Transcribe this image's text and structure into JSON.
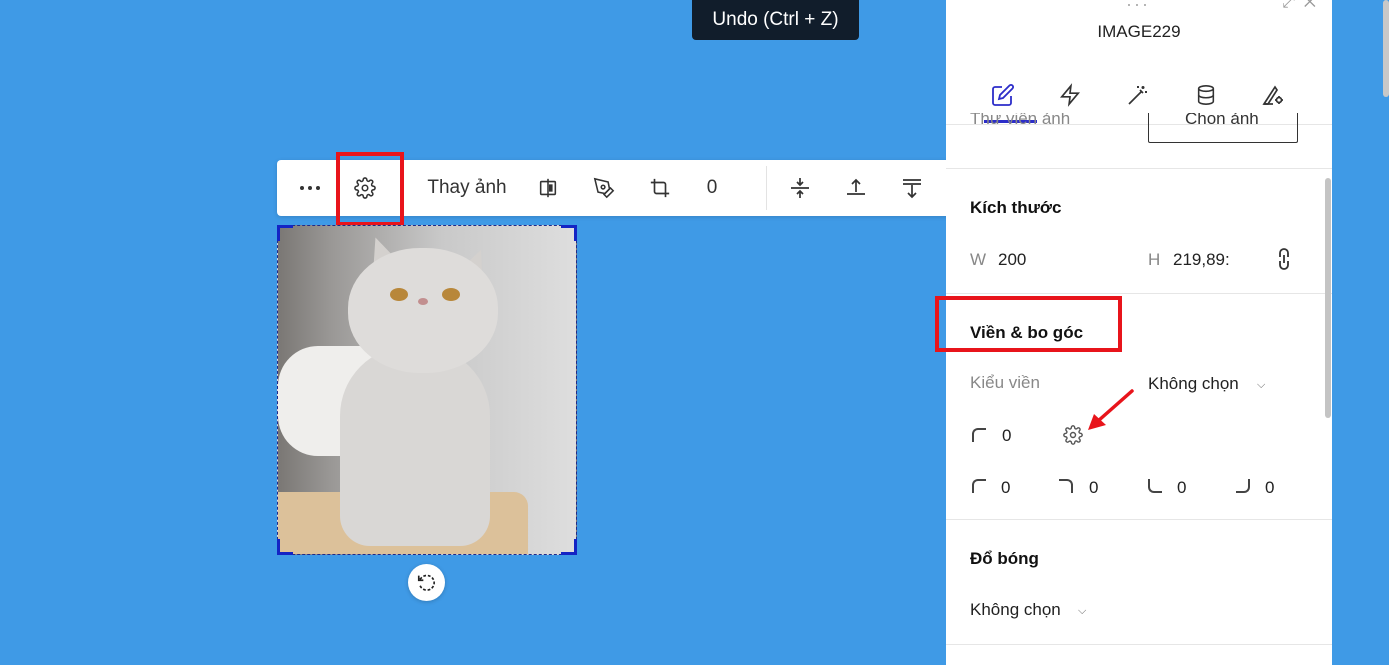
{
  "tooltip": {
    "text": "Undo (Ctrl + Z)"
  },
  "toolbar": {
    "more_icon": "more-horizontal-icon",
    "settings_icon": "gear-icon",
    "replace_label": "Thay ảnh",
    "flip_icon": "flip-icon",
    "pen_icon": "pen-icon",
    "crop_icon": "crop-icon",
    "rotation_value": "0",
    "align_icons": [
      "align-vertical-center-icon",
      "align-top-icon",
      "align-bottom-icon"
    ]
  },
  "panel": {
    "title": "IMAGE229",
    "tabs": [
      "edit-icon",
      "lightning-icon",
      "magic-wand-icon",
      "database-icon",
      "advanced-settings-icon"
    ],
    "library_label": "Thư viện ảnh",
    "choose_image_label": "Chọn ảnh",
    "size": {
      "title": "Kích thước",
      "w_label": "W",
      "w_value": "200",
      "h_label": "H",
      "h_value": "219,89:"
    },
    "border": {
      "title": "Viền & bo góc",
      "style_label": "Kiểu viền",
      "style_value": "Không chọn",
      "radius_all": "0",
      "radius_tl": "0",
      "radius_tr": "0",
      "radius_bl": "0",
      "radius_br": "0"
    },
    "shadow": {
      "title": "Đổ bóng",
      "value": "Không chọn"
    }
  },
  "colors": {
    "canvas": "#3f9ae6",
    "highlight": "#e8141b",
    "accent": "#2c2dc9"
  }
}
